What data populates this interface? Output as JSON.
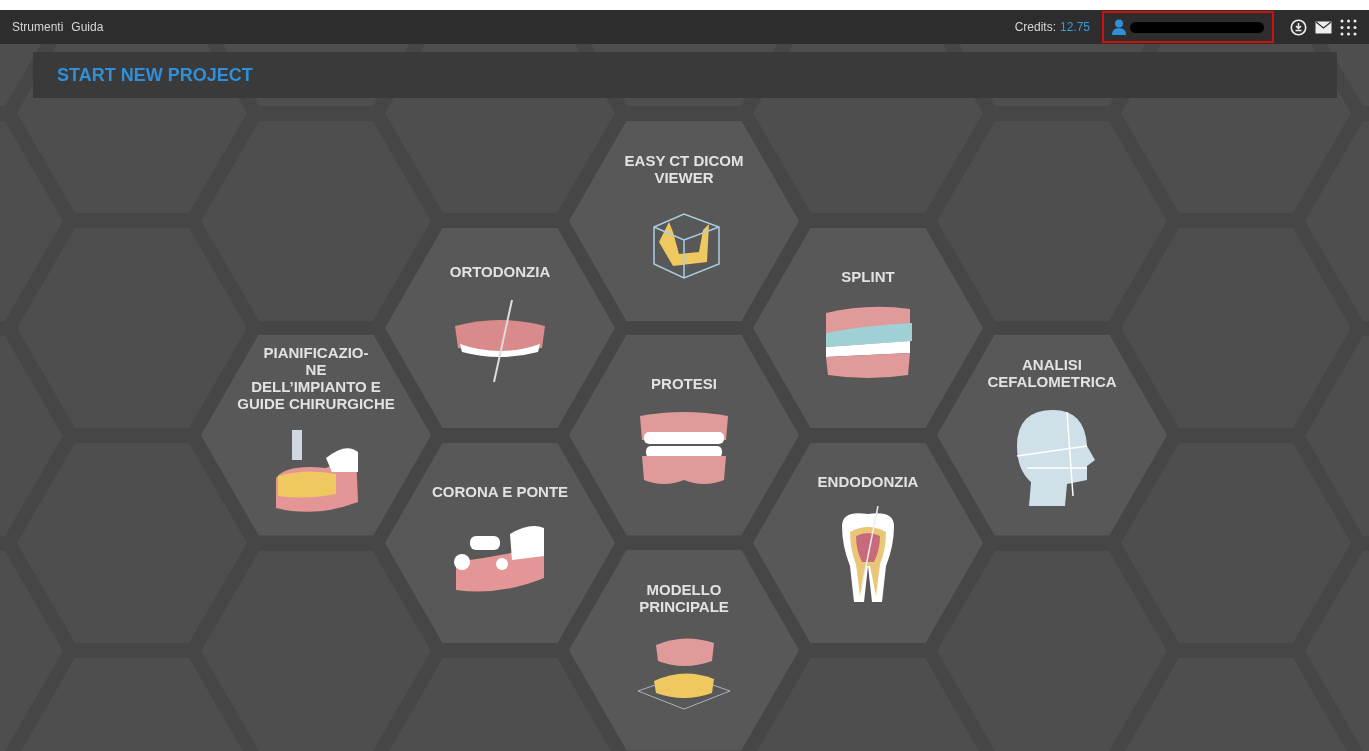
{
  "menu": [
    "Strumenti",
    "Guida"
  ],
  "account": {
    "credits_label": "Credits:",
    "credits_value": "12.75"
  },
  "header": {
    "title": "START NEW PROJECT"
  },
  "tiles": [
    {
      "title": "EASY CT DICOM VIEWER",
      "kind": "ct"
    },
    {
      "title": "ORTODONZIA",
      "kind": "ortho"
    },
    {
      "title": "SPLINT",
      "kind": "splint"
    },
    {
      "title": "PIANIFICAZIO-\nNE\nDELL’IMPIANTO E\nGUIDE CHIRURGICHE",
      "kind": "implant"
    },
    {
      "title": "PROTESI",
      "kind": "denture"
    },
    {
      "title": "ANALISI\nCEFALOMETRICA",
      "kind": "ceph"
    },
    {
      "title": "CORONA E PONTE",
      "kind": "bridge"
    },
    {
      "title": "ENDODONZIA",
      "kind": "endo"
    },
    {
      "title": "MODELLO\nPRINCIPALE",
      "kind": "model"
    }
  ]
}
